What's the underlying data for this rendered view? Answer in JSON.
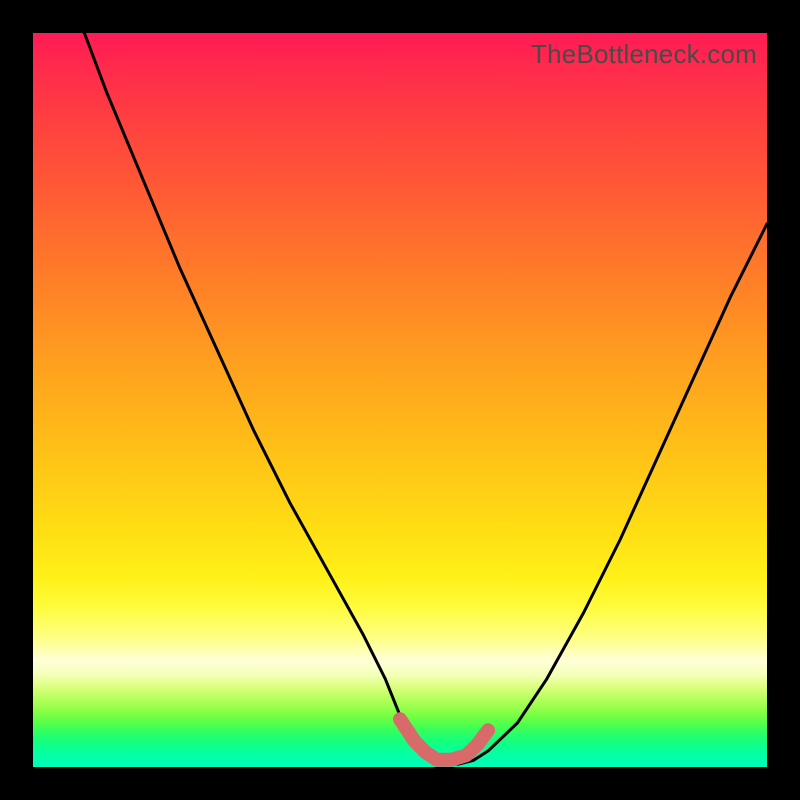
{
  "watermark": {
    "text": "TheBottleneck.com"
  },
  "chart_data": {
    "type": "line",
    "title": "",
    "xlabel": "",
    "ylabel": "",
    "xlim": [
      0,
      100
    ],
    "ylim": [
      0,
      100
    ],
    "series": [
      {
        "name": "bottleneck-curve",
        "x": [
          7,
          10,
          15,
          20,
          25,
          30,
          35,
          40,
          45,
          48,
          50,
          52,
          54,
          56,
          58,
          60,
          62,
          66,
          70,
          75,
          80,
          85,
          90,
          95,
          100
        ],
        "values": [
          100,
          92,
          80,
          68,
          57,
          46,
          36,
          27,
          18,
          12,
          7,
          3.5,
          1.2,
          0.4,
          0.4,
          0.9,
          2.2,
          6,
          12,
          21,
          31,
          42,
          53,
          64,
          74
        ]
      }
    ],
    "highlight": {
      "name": "trough-marker",
      "x": [
        50,
        52,
        53.5,
        55,
        57,
        59,
        60.5,
        62
      ],
      "values": [
        6.5,
        3.5,
        2,
        1,
        1,
        1.6,
        3,
        5
      ]
    },
    "colors": {
      "curve": "#000000",
      "highlight": "#d96a6a",
      "background_top": "#ff1b55",
      "background_bottom": "#00ffb8"
    }
  }
}
